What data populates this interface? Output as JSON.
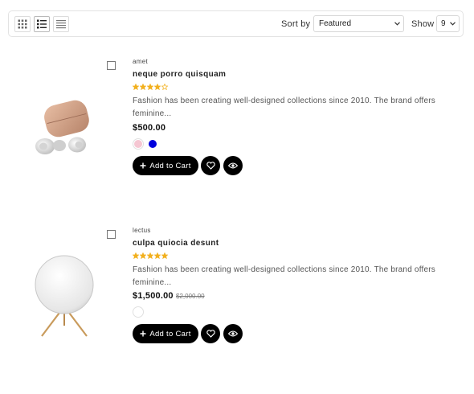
{
  "toolbar": {
    "views": [
      {
        "icon": "grid-view-icon",
        "active": false
      },
      {
        "icon": "list-view-icon",
        "active": true
      },
      {
        "icon": "compact-list-view-icon",
        "active": false
      }
    ],
    "sort_label": "Sort by",
    "sort_value": "Featured",
    "show_label": "Show",
    "show_value": "9"
  },
  "products": [
    {
      "vendor": "amet",
      "title": "neque porro quisquam",
      "rating": 4,
      "rating_max": 5,
      "description": "Fashion has been creating well-designed collections since 2010. The brand offers feminine...",
      "price": "$500.00",
      "compare_price": "",
      "swatches": [
        {
          "color": "#f5c6d2",
          "label": "pink"
        },
        {
          "color": "#0000dd",
          "label": "blue"
        }
      ],
      "add_to_cart": "Add to Cart",
      "image": "wireless-earbuds-image"
    },
    {
      "vendor": "lectus",
      "title": "culpa quiocia desunt",
      "rating": 5,
      "rating_max": 5,
      "description": "Fashion has been creating well-designed collections since 2010. The brand offers feminine...",
      "price": "$1,500.00",
      "compare_price": "$2,000.00",
      "swatches": [
        {
          "color": "#ffffff",
          "label": "white"
        }
      ],
      "add_to_cart": "Add to Cart",
      "image": "round-speaker-image"
    }
  ],
  "colors": {
    "star": "#f2b01e",
    "star_empty": "#f2b01e",
    "button": "#000000"
  }
}
